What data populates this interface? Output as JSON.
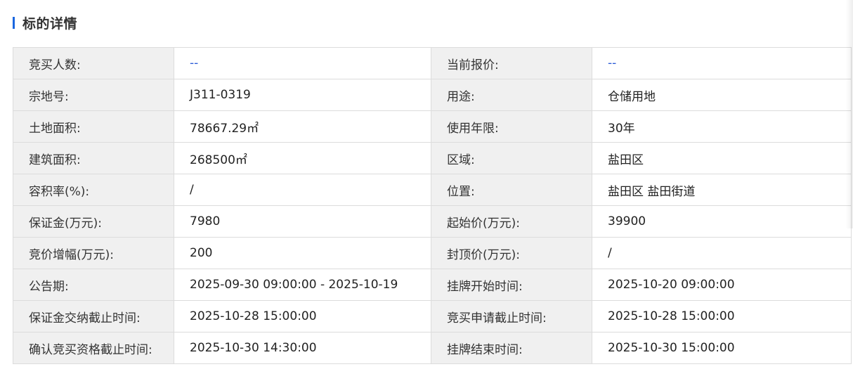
{
  "section": {
    "title": "标的详情",
    "accent_color": "#1a66e0"
  },
  "rows": [
    {
      "label1": "竞买人数:",
      "value1": "--",
      "label2": "当前报价:",
      "value2": "--"
    },
    {
      "label1": "宗地号:",
      "value1": "J311-0319",
      "label2": "用途:",
      "value2": "仓储用地"
    },
    {
      "label1": "土地面积:",
      "value1": "78667.29㎡",
      "label2": "使用年限:",
      "value2": "30年"
    },
    {
      "label1": "建筑面积:",
      "value1": "268500㎡",
      "label2": "区域:",
      "value2": "盐田区"
    },
    {
      "label1": "容积率(%):",
      "value1": "/",
      "label2": "位置:",
      "value2": "盐田区 盐田街道"
    },
    {
      "label1": "保证金(万元):",
      "value1": "7980",
      "label2": "起始价(万元):",
      "value2": "39900"
    },
    {
      "label1": "竞价增幅(万元):",
      "value1": "200",
      "label2": "封顶价(万元):",
      "value2": "/"
    },
    {
      "label1": "公告期:",
      "value1": "2025-09-30 09:00:00 - 2025-10-19",
      "label2": "挂牌开始时间:",
      "value2": "2025-10-20 09:00:00"
    },
    {
      "label1": "保证金交纳截止时间:",
      "value1": "2025-10-28 15:00:00",
      "label2": "竞买申请截止时间:",
      "value2": "2025-10-28 15:00:00"
    },
    {
      "label1": "确认竞买资格截止时间:",
      "value1": "2025-10-30 14:30:00",
      "label2": "挂牌结束时间:",
      "value2": "2025-10-30 15:00:00"
    }
  ]
}
